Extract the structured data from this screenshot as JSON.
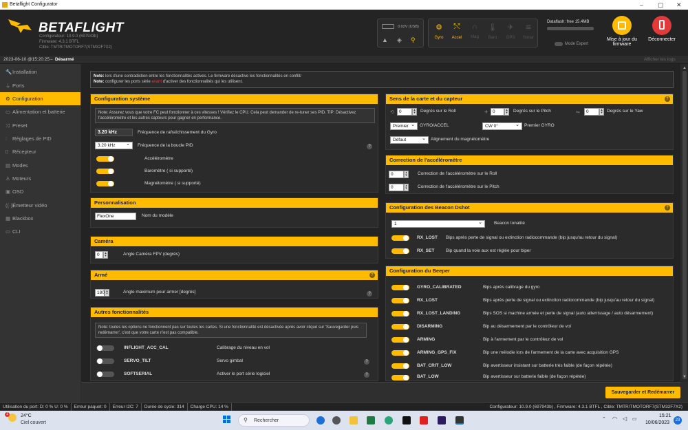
{
  "window": {
    "title": "Betaflight Configurator",
    "min": "–",
    "max": "▢",
    "close": "✕"
  },
  "brand": {
    "name": "BETAFLIGHT",
    "configurator": "Configurateur: 10.9.0 (697943b)",
    "firmware": "Firmware: 4.3.1 BTFL",
    "target": "Cible: TMTR/TMOTORF7(STM32F7X2)"
  },
  "port": {
    "voltage": "0.02V (USB)"
  },
  "sensors": [
    {
      "label": "Gyro",
      "icon": "gyro-icon",
      "active": true
    },
    {
      "label": "Accel",
      "icon": "accel-icon",
      "active": true
    },
    {
      "label": "Mag",
      "icon": "mag-icon",
      "active": false
    },
    {
      "label": "Baro",
      "icon": "baro-icon",
      "active": false
    },
    {
      "label": "GPS",
      "icon": "gps-icon",
      "active": false
    },
    {
      "label": "Sonar",
      "icon": "sonar-icon",
      "active": false
    }
  ],
  "dataflash": "Dataflash: free 15.4MB",
  "expert_mode": "Mode Expert",
  "update_firmware": "Mise à jour du firmware",
  "disconnect": "Déconnecter",
  "status": {
    "datetime": "2023-06-10 @15:20:25",
    "state": "Désarmé",
    "show_logs": "Afficher les logs"
  },
  "nav": [
    {
      "label": "Installation",
      "icon": "wrench-icon"
    },
    {
      "label": "Ports",
      "icon": "plug-icon"
    },
    {
      "label": "Configuration",
      "icon": "gear-icon",
      "active": true
    },
    {
      "label": "Alimentation et batterie",
      "icon": "battery-icon"
    },
    {
      "label": "Preset",
      "icon": "preset-icon"
    },
    {
      "label": "Réglages de PID",
      "icon": "pid-icon"
    },
    {
      "label": "Récepteur",
      "icon": "receiver-icon"
    },
    {
      "label": "Modes",
      "icon": "modes-icon"
    },
    {
      "label": "Moteurs",
      "icon": "motor-icon"
    },
    {
      "label": "OSD",
      "icon": "osd-icon"
    },
    {
      "label": "Émetteur vidéo",
      "icon": "vtx-icon"
    },
    {
      "label": "Blackbox",
      "icon": "blackbox-icon"
    },
    {
      "label": "CLI",
      "icon": "cli-icon"
    }
  ],
  "note": {
    "l1_bold": "Note:",
    "l1": " lors d'une contradiction entre les fonctionnalités actives. Le firmware désactive les fonctionnalités en conflit/",
    "l2_bold": "Note:",
    "l2a": " configurer les ports série ",
    "l2link": "avant",
    "l2b": " d'activer des fonctionnalités qui les utilisent."
  },
  "system": {
    "title": "Configuration système",
    "note": "Note: Assurez vous que votre FC peut fonctionner à ces vitesses ! Vérifiez le CPU. Cela peut demander de re-tuner ses PID. TIP: Désactivez l'accéléromètre et les autres capteurs pour gagner en performance.",
    "gyro_rate": "3.20 kHz",
    "gyro_label": "Fréquence de rafraîchissement du Gyro",
    "pid_rate": "3.20 kHz",
    "pid_label": "Fréquence de la boucle PID",
    "accel": "Accéléromètre",
    "baro": "Baromètre ( si supporté)",
    "mag": "Magnétomètre ( si supporté)"
  },
  "perso": {
    "title": "Personnalisation",
    "name": "FlexOne",
    "label": "Nom du modèle"
  },
  "camera": {
    "title": "Caméra",
    "value": "0",
    "label": "Angle Caméra FPV (degrés)"
  },
  "arm": {
    "title": "Armé",
    "value": "180",
    "label": "Angle maximum pour armer [degrés]"
  },
  "other": {
    "title": "Autres fonctionnalités",
    "note": "Note: toutes les options ne fonctionnent pas sur toutes les cartes. Si une fonctionnalité est désactivée après avoir cliqué sur 'Sauvegarder puis redémarrer', c'est que votre carte n'est pas compatible.",
    "rows": [
      {
        "name": "INFLIGHT_ACC_CAL",
        "desc": "Calibrage du niveau en vol"
      },
      {
        "name": "SERVO_TILT",
        "desc": "Servo gimbal"
      },
      {
        "name": "SOFTSERIAL",
        "desc": "Activer le port série logiciel"
      }
    ]
  },
  "board": {
    "title": "Sens de la carte et du capteur",
    "roll": "0",
    "roll_label": "Degrés sur le Roll",
    "pitch": "0",
    "pitch_label": "Degrés sur le Pitch",
    "yaw": "0",
    "yaw_label": "Degrés sur le Yaw",
    "gyro_sel": "Premier",
    "gyro_sel_label": "GYRO/ACCEL",
    "gyro_align": "CW 0°",
    "gyro_align_label": "Premier GYRO",
    "mag_align": "Défaut",
    "mag_align_label": "Alignement du magnétomètre"
  },
  "accelcorr": {
    "title": "Correction de l'accéléromètre",
    "roll": "0",
    "roll_label": "Correction de l'accéléromètre sur le Roll",
    "pitch": "0",
    "pitch_label": "Correction de l'accéléromètre sur le Pitch"
  },
  "beacon": {
    "title": "Configuration des Beacon Dshot",
    "tone": "1",
    "tone_label": "Beacon tonalité",
    "rows": [
      {
        "name": "RX_LOST",
        "desc": "Bips après perte de signal ou extinction radiocommande (bip jusqu'au retour du signal)"
      },
      {
        "name": "RX_SET",
        "desc": "Bip quand la voie aux est réglée pour biper"
      }
    ]
  },
  "beeper": {
    "title": "Configuration du Beeper",
    "rows": [
      {
        "name": "GYRO_CALIBRATED",
        "desc": "Bips après calibrage du gyro"
      },
      {
        "name": "RX_LOST",
        "desc": "Bips après perte de signal ou extinction radiocommande (bip jusqu'au retour du signal)"
      },
      {
        "name": "RX_LOST_LANDING",
        "desc": "Bips SOS si machine armée et perte de signal (auto atterrissage / auto désarmement)"
      },
      {
        "name": "DISARMING",
        "desc": "Bip au désarmement par le contrôleur de vol"
      },
      {
        "name": "ARMING",
        "desc": "Bip à l'armement par le contrôleur de vol"
      },
      {
        "name": "ARMING_GPS_FIX",
        "desc": "Bip une mélodie lors de l'armement de la carte avec acquisition GPS"
      },
      {
        "name": "BAT_CRIT_LOW",
        "desc": "Bip avertisseur insistant sur batterie très faible (de façon répétée)"
      },
      {
        "name": "BAT_LOW",
        "desc": "Bip avertisseur sur batterie faible (de façon répétée)"
      }
    ]
  },
  "save": "Sauvegarder et Redémarrer",
  "footer": {
    "port": "Utilisation du port: D: 0 % U: 0 %",
    "packet": "Erreur paquet: 0",
    "i2c": "Erreur I2C: 7",
    "cycle": "Durée de cycle: 314",
    "cpu": "Charge CPU: 14 %",
    "right": "Configurateur: 10.9.0 (697943b) , Firmware: 4.3.1 BTFL , Cible: TMTR/TMOTORF7(STM32F7X2)"
  },
  "taskbar": {
    "temp": "24°C",
    "weather": "Ciel couvert",
    "search": "Rechercher",
    "time": "15:21",
    "date": "10/06/2023",
    "badge": "23",
    "weather_badge": "1"
  }
}
